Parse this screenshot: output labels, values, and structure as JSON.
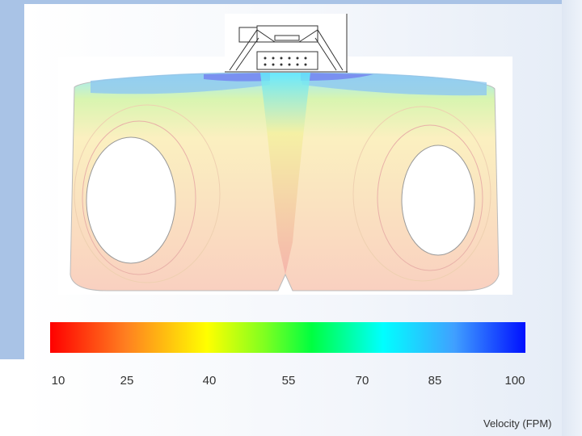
{
  "colorbar": {
    "ticks": [
      "10",
      "25",
      "40",
      "55",
      "70",
      "85",
      "100"
    ],
    "label": "Velocity (FPM)",
    "colors": [
      "#ff0000",
      "#ffff00",
      "#00ff40",
      "#00ffff",
      "#0010ff"
    ]
  }
}
